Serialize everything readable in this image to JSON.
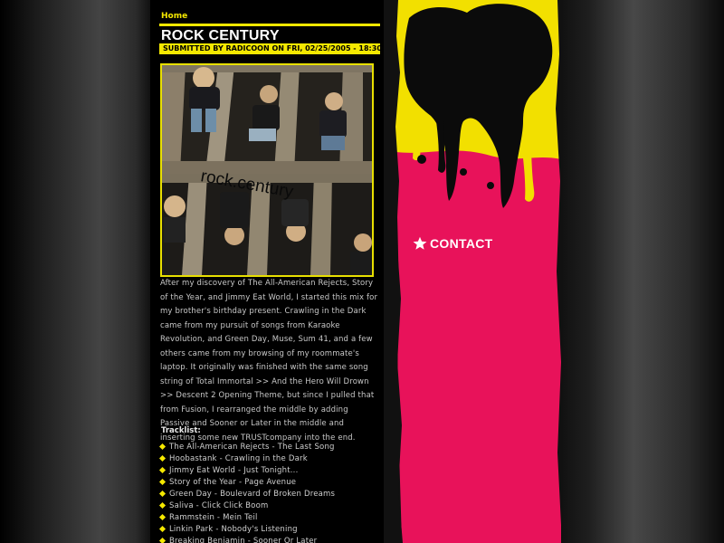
{
  "nav": {
    "home_label": "Home"
  },
  "post": {
    "title": "ROCK CENTURY",
    "byline": "SUBMITTED BY RADICOON ON FRI, 02/25/2005 - 18:30",
    "image_caption": "rock.century",
    "body": "After my discovery of The All-American Rejects, Story of the Year, and Jimmy Eat World, I started this mix for my brother's birthday present. Crawling in the Dark came from my pursuit of songs from Karaoke Revolution, and Green Day, Muse, Sum 41, and a few others came from my browsing of my roommate's laptop. It originally was finished with the same song string of Total Immortal >> And the Hero Will Drown >> Descent 2 Opening Theme, but since I pulled that from Fusion, I rearranged the middle by adding Passive and Sooner or Later in the middle and inserting some new TRUSTcompany into the end.",
    "tracklist_heading": "Tracklist:",
    "tracks": [
      "The All-American Rejects - The Last Song",
      "Hoobastank - Crawling in the Dark",
      "Jimmy Eat World - Just Tonight...",
      "Story of the Year - Page Avenue",
      "Green Day - Boulevard of Broken Dreams",
      "Saliva - Click Click Boom",
      "Rammstein - Mein Teil",
      "Linkin Park - Nobody's Listening",
      "Breaking Benjamin - Sooner Or Later"
    ]
  },
  "sidebar": {
    "contact_label": "CONTACT",
    "contact_icon": "star-icon"
  },
  "colors": {
    "accent_yellow": "#f5e800",
    "magenta": "#e8125a",
    "background": "#000000"
  }
}
